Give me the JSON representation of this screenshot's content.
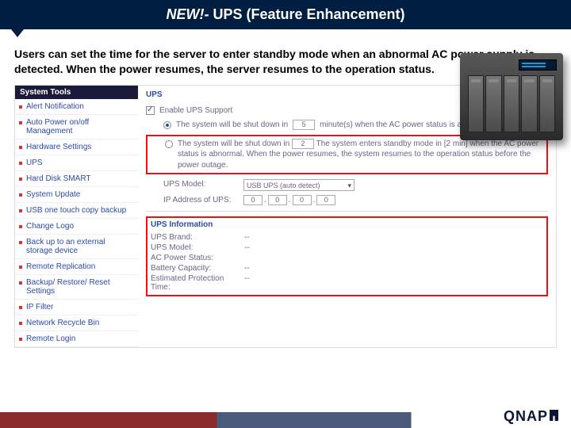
{
  "header": {
    "prefix": "NEW!-",
    "rest": " UPS (Feature Enhancement)"
  },
  "description": "Users can set the time for the server to enter standby mode when an abnormal AC power supply is detected. When the power resumes, the server resumes to the operation status.",
  "sidebar": {
    "title": "System Tools",
    "items": [
      {
        "label": "Alert Notification"
      },
      {
        "label": "Auto Power on/off Management"
      },
      {
        "label": "Hardware Settings"
      },
      {
        "label": "UPS"
      },
      {
        "label": "Hard Disk SMART"
      },
      {
        "label": "System Update"
      },
      {
        "label": "USB one touch copy backup"
      },
      {
        "label": "Change Logo"
      },
      {
        "label": "Back up to an external storage device"
      },
      {
        "label": "Remote Replication"
      },
      {
        "label": "Backup/ Restore/ Reset Settings"
      },
      {
        "label": "IP Filter"
      },
      {
        "label": "Network Recycle Bin"
      },
      {
        "label": "Remote Login"
      }
    ]
  },
  "main": {
    "section": "UPS",
    "enable": "Enable UPS Support",
    "opt1_a": "The system will be shut down in",
    "opt1_val": "5",
    "opt1_b": "minute(s) when the AC power status is abnormal.",
    "opt2_a": "The system will be shut down in",
    "opt2_val": "2",
    "opt2_b": "The system enters standby mode in [2 min] when the AC power status is abnormal. When the power resumes, the system resumes to the operation status before the power outage.",
    "model_lbl": "UPS Model:",
    "model_val": "USB UPS (auto detect)",
    "ip_lbl": "IP Address of UPS:",
    "ip": [
      "0",
      "0",
      "0",
      "0"
    ],
    "info_title": "UPS Information",
    "info": [
      {
        "lbl": "UPS Brand:",
        "val": "--"
      },
      {
        "lbl": "UPS Model:",
        "val": "--"
      },
      {
        "lbl": "AC Power Status:",
        "val": ""
      },
      {
        "lbl": "Battery Capacity:",
        "val": "--"
      },
      {
        "lbl": "Estimated Protection Time:",
        "val": "--"
      }
    ]
  },
  "brand": "QNAP"
}
